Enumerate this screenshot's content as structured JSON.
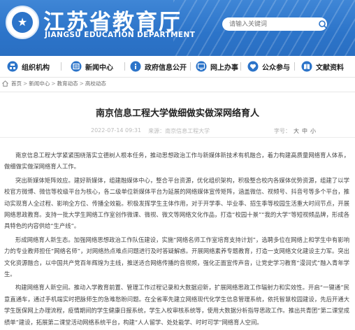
{
  "header": {
    "site_name": "江苏省教育厅",
    "site_name_en": "JIANGSU EDUCATION DEPARTMENT",
    "search_placeholder": "请输入关键词"
  },
  "nav": [
    {
      "label": "组织机构",
      "icon": "org-icon"
    },
    {
      "label": "新闻中心",
      "icon": "news-icon"
    },
    {
      "label": "政府信息公开",
      "icon": "info-icon"
    },
    {
      "label": "网上办事",
      "icon": "online-service-icon"
    },
    {
      "label": "公众参与",
      "icon": "participation-icon"
    },
    {
      "label": "文献资料",
      "icon": "documents-icon"
    }
  ],
  "breadcrumb": {
    "items": [
      "首页",
      "新闻中心",
      "教育动态",
      "高校动态"
    ],
    "separator": ">"
  },
  "article": {
    "title": "南京信息工程大学做细做实做深网络育人",
    "date": "2022-07-14 09:31",
    "source": "来源：南京信息工程大学",
    "fontsize_label": "字号：",
    "fontsize_options": [
      "大",
      "中",
      "小"
    ],
    "paragraphs": [
      "南京信息工程大学紧紧围绕落实立德树人根本任务，推动思想政治工作与新媒体新技术有机融合，着力构建高质量网络育人体系，做细做实做深网络育人工作。",
      "突出新媒体矩阵效应。建好新媒体，组建融媒体中心，整合平台资源，优化组织架构，积极整合校内各媒体优势资源，组建了以学校官方微博、微信等校级平台为核心，各二级单位新媒体平台为延展的网络媒体宣传矩阵，涵盖微信、视频号、抖音号等多个平台，推动实现育人全过程、影响全方位、传播全效能。积极发挥学生主体作用，对于开学季、毕业季、招生季等校园生活重大时间节点，开展网络思政教育。支持一批大学生网络工作室创作微课、微视、微文等网络文化作品，打造“校园十景”“我的大学”等短视频品牌，形成各具特色的内容供给“生产线”。",
      "形成网络育人新生态。加强网络思想政治工作队伍建设，实施“网络名师工作室培育支持计划”，选聘多位在网络上和学生中有影响力的专业教师担任“网络名师”，对网络热点难点问题进行及时答疑解惑。开展网络素养专题教育，打造一支网络文化建设主力军。突出文化资源融合，以中国共产党百年辉煌为主线，推送适合网络传播的音视频，强化正面宣传声音，让党史学习教育“漫润式”融入青年学生。",
      "构建网络育人新空间。推动入学教育前置、管理工作过程记录和大数据迎新，扩展网络思政工作辐射力和实效性。开启“一键通”民意直通车，通过手机端实时把脉师生的急难愁盼问题。在全省率先建立网络现代化学生信息管理系统，依托智慧校园建设，先后开通大学生医保网上办理流程，疫情期间的学生健康日报系统，学生入校审核系统等，使用大数据分析指导思政工作。推出共青团“第二课堂成绩单”建设，拓展第二课堂活动网络系统平台，构建“人人留学、处处能学、时时可学”网络育人空间。"
    ]
  }
}
